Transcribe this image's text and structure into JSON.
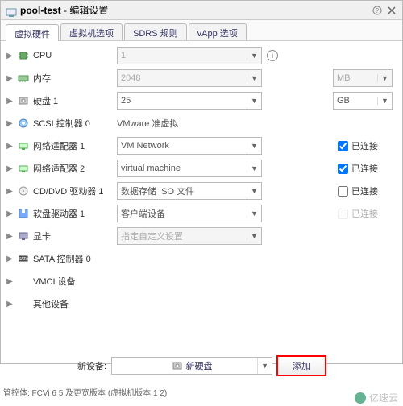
{
  "title": {
    "vm_name": "pool-test",
    "action": "编辑设置"
  },
  "tabs": [
    {
      "label": "虚拟硬件",
      "active": true
    },
    {
      "label": "虚拟机选项"
    },
    {
      "label": "SDRS 规则"
    },
    {
      "label": "vApp 选项"
    }
  ],
  "rows": {
    "cpu": {
      "label": "CPU",
      "value": "1"
    },
    "memory": {
      "label": "内存",
      "value": "2048",
      "unit": "MB"
    },
    "disk1": {
      "label": "硬盘 1",
      "value": "25",
      "unit": "GB"
    },
    "scsi": {
      "label": "SCSI 控制器 0",
      "value": "VMware 准虚拟"
    },
    "nic1": {
      "label": "网络适配器 1",
      "value": "VM Network",
      "connected": "已连接",
      "conn_checked": true
    },
    "nic2": {
      "label": "网络适配器 2",
      "value": "virtual machine",
      "connected": "已连接",
      "conn_checked": true
    },
    "cdrom": {
      "label": "CD/DVD 驱动器 1",
      "value": "数据存储 ISO 文件",
      "connected": "已连接",
      "conn_checked": false
    },
    "floppy": {
      "label": "软盘驱动器 1",
      "value": "客户端设备",
      "connected": "已连接",
      "conn_checked": false,
      "conn_disabled": true
    },
    "video": {
      "label": "显卡",
      "value": "指定自定义设置"
    },
    "sata": {
      "label": "SATA 控制器 0"
    },
    "vmci": {
      "label": "VMCI 设备"
    },
    "other": {
      "label": "其他设备"
    }
  },
  "footer": {
    "label": "新设备:",
    "device": "新硬盘",
    "add": "添加"
  },
  "watermark": "亿速云",
  "bottom_text": "管控体: FCVi 6 5 及更宽版本 (虚拟机版本 1 2)"
}
